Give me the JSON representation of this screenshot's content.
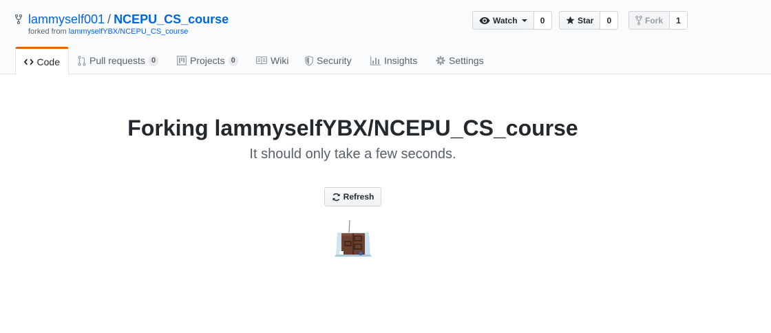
{
  "repo": {
    "owner": "lammyself001",
    "separator": "/",
    "name": "NCEPU_CS_course",
    "forked_from_prefix": "forked from",
    "forked_from_link": "lammyselfYBX/NCEPU_CS_course"
  },
  "actions": {
    "watch": {
      "label": "Watch",
      "count": "0",
      "icon": "eye-icon"
    },
    "star": {
      "label": "Star",
      "count": "0",
      "icon": "star-icon"
    },
    "fork": {
      "label": "Fork",
      "count": "1",
      "icon": "repo-forked-icon"
    }
  },
  "tabs": [
    {
      "label": "Code",
      "icon": "code-icon",
      "selected": true
    },
    {
      "label": "Pull requests",
      "icon": "git-pull-request-icon",
      "counter": "0"
    },
    {
      "label": "Projects",
      "icon": "project-icon",
      "counter": "0"
    },
    {
      "label": "Wiki",
      "icon": "book-icon"
    },
    {
      "label": "Security",
      "icon": "shield-icon"
    },
    {
      "label": "Insights",
      "icon": "graph-icon"
    },
    {
      "label": "Settings",
      "icon": "gear-icon"
    }
  ],
  "main": {
    "heading": "Forking lammyselfYBX/NCEPU_CS_course",
    "subheading": "It should only take a few seconds.",
    "refresh_label": "Refresh"
  },
  "colors": {
    "link": "#0366d6",
    "selected_tab_accent": "#e36209",
    "text": "#24292e",
    "muted": "#586069"
  }
}
